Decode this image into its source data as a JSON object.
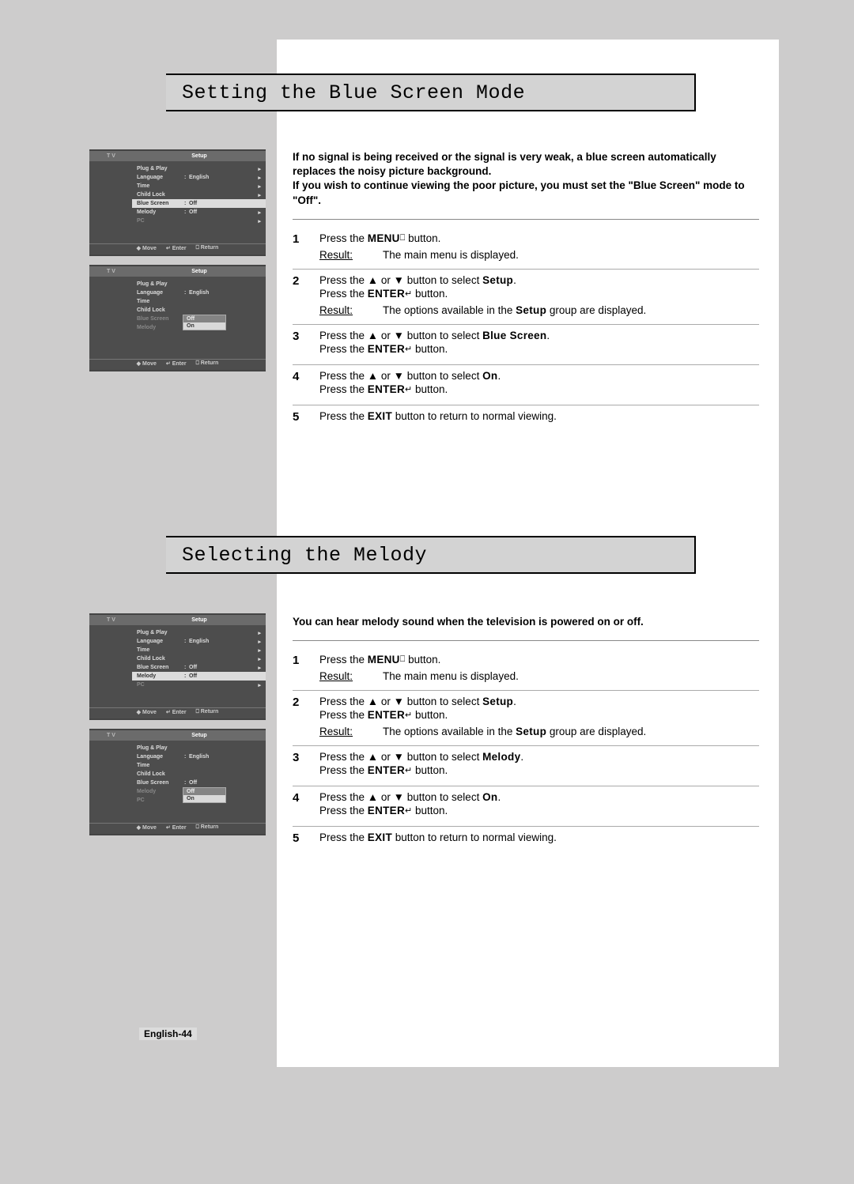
{
  "page_number": "English-44",
  "sections": [
    {
      "title": "Setting the Blue Screen Mode",
      "intro": "If no signal is being received or the signal is very weak, a blue screen automatically replaces the noisy picture background.\nIf you wish to continue viewing the poor picture, you must set the \"Blue Screen\" mode to \"Off\".",
      "steps": [
        {
          "num": "1",
          "lines": [
            "Press the <b>MENU</b><g>⎕</g> button."
          ],
          "result": "The main menu is displayed."
        },
        {
          "num": "2",
          "lines": [
            "Press the ▲ or ▼ button to select <b>Setup</b>.",
            "Press the <b>ENTER</b><g>↵</g> button."
          ],
          "result": "The options available in the <b>Setup</b> group are displayed."
        },
        {
          "num": "3",
          "lines": [
            "Press the ▲ or ▼ button to select <b>Blue Screen</b>.",
            "Press the <b>ENTER</b><g>↵</g> button."
          ]
        },
        {
          "num": "4",
          "lines": [
            "Press the ▲ or ▼ button to select <b>On</b>.",
            "Press the <b>ENTER</b><g>↵</g> button."
          ]
        },
        {
          "num": "5",
          "lines": [
            "Press the <b>EXIT</b> button to return to normal viewing."
          ]
        }
      ],
      "screens": [
        {
          "selected": "Blue Screen",
          "highlight_type": "row",
          "items": [
            {
              "label": "Plug & Play",
              "value": "",
              "arrow": true
            },
            {
              "label": "Language",
              "value": "English",
              "arrow": true,
              "colon": true
            },
            {
              "label": "Time",
              "value": "",
              "arrow": true
            },
            {
              "label": "Child Lock",
              "value": "",
              "arrow": true
            },
            {
              "label": "Blue Screen",
              "value": "Off",
              "arrow": true,
              "colon": true
            },
            {
              "label": "Melody",
              "value": "Off",
              "arrow": true,
              "colon": true
            },
            {
              "label": "PC",
              "value": "",
              "arrow": true,
              "dim": true
            }
          ],
          "footer": [
            "◆ Move",
            "↵ Enter",
            "⎕ Return"
          ]
        },
        {
          "selected": "Blue Screen",
          "highlight_type": "dropdown",
          "dropdown_on": "On",
          "dropdown_options": [
            "Off",
            "On"
          ],
          "items": [
            {
              "label": "Plug & Play",
              "value": ""
            },
            {
              "label": "Language",
              "value": "English",
              "colon": true
            },
            {
              "label": "Time",
              "value": ""
            },
            {
              "label": "Child Lock",
              "value": ""
            },
            {
              "label": "Blue Screen",
              "value": "",
              "colon": true,
              "dim": true
            },
            {
              "label": "Melody",
              "value": "",
              "colon": true,
              "dim": true
            }
          ],
          "footer": [
            "◆ Move",
            "↵ Enter",
            "⎕ Return"
          ]
        }
      ]
    },
    {
      "title": "Selecting the Melody",
      "intro": "You can hear melody sound when the television is powered on or off.",
      "steps": [
        {
          "num": "1",
          "lines": [
            "Press the <b>MENU</b><g>⎕</g> button."
          ],
          "result": "The main menu is displayed."
        },
        {
          "num": "2",
          "lines": [
            "Press the ▲ or ▼ button to select <b>Setup</b>.",
            "Press the <b>ENTER</b><g>↵</g> button."
          ],
          "result": "The options available in the <b>Setup</b> group are displayed."
        },
        {
          "num": "3",
          "lines": [
            "Press the ▲ or ▼ button to select <b>Melody</b>.",
            "Press the <b>ENTER</b><g>↵</g> button."
          ]
        },
        {
          "num": "4",
          "lines": [
            "Press the ▲ or ▼ button to select <b>On</b>.",
            "Press the <b>ENTER</b><g>↵</g> button."
          ]
        },
        {
          "num": "5",
          "lines": [
            "Press the <b>EXIT</b> button to return to normal viewing."
          ]
        }
      ],
      "screens": [
        {
          "selected": "Melody",
          "highlight_type": "row",
          "items": [
            {
              "label": "Plug & Play",
              "value": "",
              "arrow": true
            },
            {
              "label": "Language",
              "value": "English",
              "arrow": true,
              "colon": true
            },
            {
              "label": "Time",
              "value": "",
              "arrow": true
            },
            {
              "label": "Child Lock",
              "value": "",
              "arrow": true
            },
            {
              "label": "Blue Screen",
              "value": "Off",
              "arrow": true,
              "colon": true
            },
            {
              "label": "Melody",
              "value": "Off",
              "arrow": true,
              "colon": true
            },
            {
              "label": "PC",
              "value": "",
              "arrow": true,
              "dim": true
            }
          ],
          "footer": [
            "◆ Move",
            "↵ Enter",
            "⎕ Return"
          ]
        },
        {
          "selected": "Melody",
          "highlight_type": "dropdown",
          "dropdown_on": "On",
          "dropdown_options": [
            "Off",
            "On"
          ],
          "items": [
            {
              "label": "Plug & Play",
              "value": ""
            },
            {
              "label": "Language",
              "value": "English",
              "colon": true
            },
            {
              "label": "Time",
              "value": ""
            },
            {
              "label": "Child Lock",
              "value": ""
            },
            {
              "label": "Blue Screen",
              "value": "Off",
              "colon": true
            },
            {
              "label": "Melody",
              "value": "",
              "dim": true,
              "colon": true
            },
            {
              "label": "PC",
              "value": "",
              "dim": true
            }
          ],
          "footer": [
            "◆ Move",
            "↵ Enter",
            "⎕ Return"
          ]
        }
      ]
    }
  ],
  "menu_header": {
    "tv": "T V",
    "setup": "Setup"
  }
}
